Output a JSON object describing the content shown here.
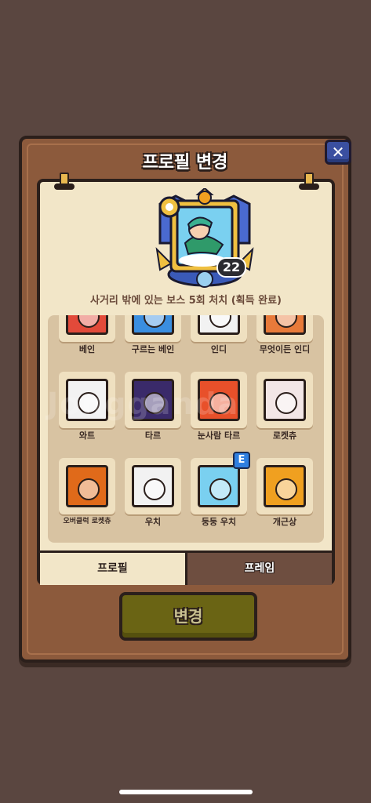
{
  "dialog": {
    "title": "프로필 변경",
    "close_label": "✕",
    "change_button": "변경"
  },
  "profile": {
    "level": "22",
    "achievement": "사거리 밖에 있는 보스 5회 처치 (획득 완료)"
  },
  "tabs": [
    {
      "label": "프로필",
      "active": true
    },
    {
      "label": "프레임",
      "active": false
    }
  ],
  "characters": [
    {
      "name": "베인",
      "color": "#e24a3a"
    },
    {
      "name": "구르는 베인",
      "color": "#3a8ee0"
    },
    {
      "name": "인디",
      "color": "#f2f2f2"
    },
    {
      "name": "무엇이든 인디",
      "color": "#e87a3a"
    },
    {
      "name": "와트",
      "color": "#f2f2f2"
    },
    {
      "name": "타르",
      "color": "#3a2a6a"
    },
    {
      "name": "눈사람 타르",
      "color": "#e8502a"
    },
    {
      "name": "로켓츄",
      "color": "#f2e6e6"
    },
    {
      "name": "오버클럭 로켓츄",
      "color": "#e06a1a"
    },
    {
      "name": "우치",
      "color": "#f2f2f2"
    },
    {
      "name": "둥둥 우치",
      "color": "#7ad0f0",
      "badge": "E"
    },
    {
      "name": "개근상",
      "color": "#f0a020"
    }
  ],
  "watermark": "Jongganda"
}
